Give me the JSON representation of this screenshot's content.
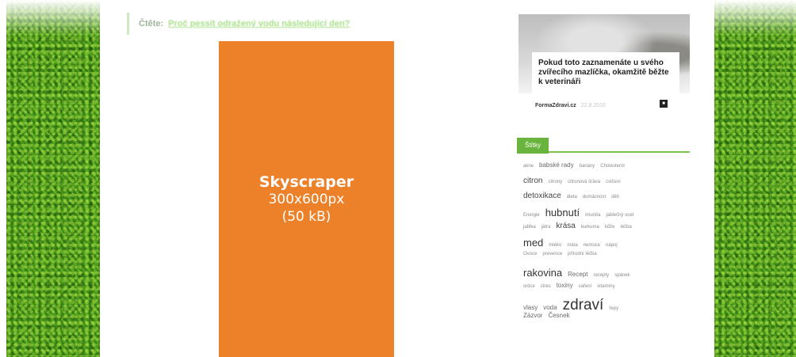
{
  "main": {
    "read_label": "Čtěte:",
    "read_link": "Proč pessit odražený vodu následující den?"
  },
  "ad": {
    "title": "Skyscraper",
    "size": "300x600px",
    "weight": "(50 kB)",
    "color": "#ec8129"
  },
  "sidebar": {
    "article": {
      "title": "Pokud toto zaznamenáte u svého zvířecího mazlíčka, okamžitě běžte k veterináři",
      "author": "FormaZdravi.cz",
      "date": "22.8.2016"
    },
    "tags_section_title": "Štítky",
    "tag_lines": [
      [
        {
          "t": "akne",
          "s": 1
        },
        {
          "t": "babské rady",
          "s": 2
        },
        {
          "t": "banány",
          "s": 1
        },
        {
          "t": "Cholesterol",
          "s": 1
        }
      ],
      [
        {
          "t": "citron",
          "s": 3
        },
        {
          "t": "citrony",
          "s": 1
        },
        {
          "t": "citronová šťáva",
          "s": 1
        },
        {
          "t": "cvičení",
          "s": 1
        }
      ],
      [
        {
          "t": "detoxikace",
          "s": 3
        },
        {
          "t": "dieta",
          "s": 1
        },
        {
          "t": "domácnost",
          "s": 1
        },
        {
          "t": "děti",
          "s": 1
        }
      ],
      [
        {
          "t": "Energie",
          "s": 1
        },
        {
          "t": "hubnutí",
          "s": 4
        },
        {
          "t": "imunita",
          "s": 1
        },
        {
          "t": "jablečný ocet",
          "s": 1
        }
      ],
      [
        {
          "t": "jablka",
          "s": 1
        },
        {
          "t": "játra",
          "s": 1
        },
        {
          "t": "krása",
          "s": 3
        },
        {
          "t": "kurkuma",
          "s": 1
        },
        {
          "t": "kůže",
          "s": 1
        },
        {
          "t": "léčba",
          "s": 1
        }
      ],
      [
        {
          "t": "med",
          "s": 4
        },
        {
          "t": "mléko",
          "s": 1
        },
        {
          "t": "máta",
          "s": 1
        },
        {
          "t": "nemoce",
          "s": 1
        },
        {
          "t": "nápoj",
          "s": 1
        }
      ],
      [
        {
          "t": "Ovoce",
          "s": 1
        },
        {
          "t": "prevence",
          "s": 1
        },
        {
          "t": "přírodní léčba",
          "s": 1
        }
      ],
      [
        {
          "t": "rakovina",
          "s": 4
        },
        {
          "t": "Recept",
          "s": 2
        },
        {
          "t": "recepty",
          "s": 1
        },
        {
          "t": "spánek",
          "s": 1
        }
      ],
      [
        {
          "t": "srdce",
          "s": 1
        },
        {
          "t": "stres",
          "s": 1
        },
        {
          "t": "toxiny",
          "s": 2
        },
        {
          "t": "vaření",
          "s": 1
        },
        {
          "t": "vitamíny",
          "s": 1
        }
      ],
      [
        {
          "t": "vlasy",
          "s": 2
        },
        {
          "t": "voda",
          "s": 2
        },
        {
          "t": "zdraví",
          "s": 5
        },
        {
          "t": "řepy",
          "s": 1
        }
      ],
      [
        {
          "t": "Zázvor",
          "s": 2
        },
        {
          "t": "Česnek",
          "s": 2
        }
      ]
    ]
  }
}
